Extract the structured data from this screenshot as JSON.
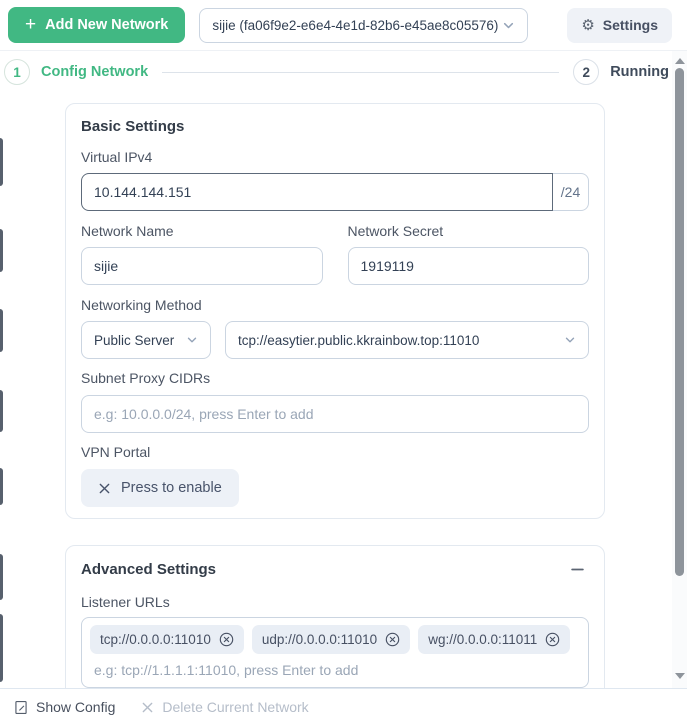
{
  "topbar": {
    "add_button_label": "Add New Network",
    "network_select_value": "sijie (fa06f9e2-e6e4-4e1d-82b6-e45ae8c05576)",
    "settings_button_label": "Settings"
  },
  "stepper": {
    "step1_number": "1",
    "step1_label": "Config Network",
    "step2_number": "2",
    "step2_label": "Running"
  },
  "basic": {
    "title": "Basic Settings",
    "virtual_ipv4_label": "Virtual IPv4",
    "virtual_ipv4_value": "10.144.144.151",
    "virtual_ipv4_suffix": "/24",
    "network_name_label": "Network Name",
    "network_name_value": "sijie",
    "network_secret_label": "Network Secret",
    "network_secret_value": "1919119",
    "networking_method_label": "Networking Method",
    "method_value": "Public Server",
    "server_url_value": "tcp://easytier.public.kkrainbow.top:11010",
    "subnet_label": "Subnet Proxy CIDRs",
    "subnet_placeholder": "e.g: 10.0.0.0/24, press Enter to add",
    "vpn_portal_label": "VPN Portal",
    "vpn_portal_button_label": "Press to enable"
  },
  "advanced": {
    "title": "Advanced Settings",
    "listener_label": "Listener URLs",
    "chips": [
      "tcp://0.0.0.0:11010",
      "udp://0.0.0.0:11010",
      "wg://0.0.0.0:11011"
    ],
    "listener_placeholder": "e.g: tcp://1.1.1.1:11010, press Enter to add"
  },
  "footer": {
    "show_config_label": "Show Config",
    "delete_network_label": "Delete Current Network"
  },
  "colors": {
    "accent_green": "#41b883",
    "input_border": "#cbd5e1",
    "focused_input_border": "#5d6a7a",
    "chip_background": "#e9eef5",
    "placeholder_text": "#9aa6b6"
  }
}
